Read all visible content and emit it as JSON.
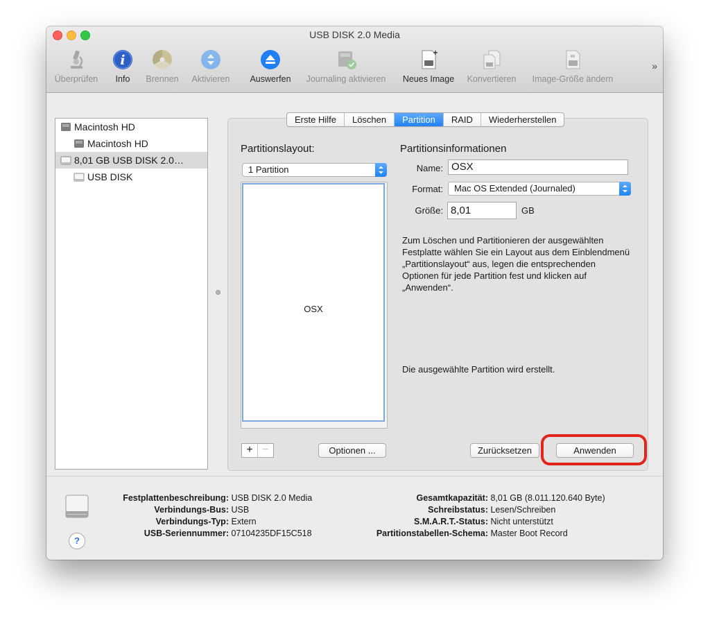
{
  "window": {
    "title": "USB DISK 2.0 Media"
  },
  "toolbar": {
    "items": [
      {
        "label": "Überprüfen",
        "icon": "microscope-icon",
        "enabled": false
      },
      {
        "label": "Info",
        "icon": "info-icon",
        "enabled": true
      },
      {
        "label": "Brennen",
        "icon": "burn-icon",
        "enabled": false
      },
      {
        "label": "Aktivieren",
        "icon": "mount-icon",
        "enabled": false
      },
      {
        "label": "Auswerfen",
        "icon": "eject-icon",
        "enabled": true
      },
      {
        "label": "Journaling aktivieren",
        "icon": "journaling-icon",
        "enabled": false
      },
      {
        "label": "Neues Image",
        "icon": "new-image-icon",
        "enabled": true
      },
      {
        "label": "Konvertieren",
        "icon": "convert-icon",
        "enabled": false
      },
      {
        "label": "Image-Größe ändern",
        "icon": "resize-image-icon",
        "enabled": false
      }
    ],
    "overflow": "»"
  },
  "sidebar": {
    "items": [
      {
        "label": "Macintosh HD",
        "indent": 0,
        "icon": "internal-disk-icon",
        "selected": false
      },
      {
        "label": "Macintosh HD",
        "indent": 1,
        "icon": "volume-icon",
        "selected": false
      },
      {
        "label": "8,01 GB USB DISK 2.0…",
        "indent": 0,
        "icon": "usb-disk-icon",
        "selected": true
      },
      {
        "label": "USB DISK",
        "indent": 1,
        "icon": "usb-volume-icon",
        "selected": false
      }
    ]
  },
  "tabs": {
    "items": [
      "Erste Hilfe",
      "Löschen",
      "Partition",
      "RAID",
      "Wiederherstellen"
    ],
    "active": "Partition"
  },
  "partition": {
    "layout_heading": "Partitionslayout:",
    "layout_value": "1 Partition",
    "partition_label": "OSX",
    "plus": "+",
    "minus": "−",
    "options_button": "Optionen ..."
  },
  "info": {
    "heading": "Partitionsinformationen",
    "name_label": "Name:",
    "name_value": "OSX",
    "format_label": "Format:",
    "format_value": "Mac OS Extended (Journaled)",
    "size_label": "Größe:",
    "size_value": "8,01",
    "size_unit": "GB",
    "description": "Zum Löschen und Partitionieren der ausgewählten Festplatte wählen Sie ein Layout aus dem Einblendmenü „Partitionslayout“ aus, legen die entsprechenden Optionen für jede Partition fest und klicken auf „Anwenden“.",
    "status": "Die ausgewählte Partition wird erstellt.",
    "revert_button": "Zurücksetzen",
    "apply_button": "Anwenden"
  },
  "footer": {
    "left": [
      {
        "key": "Festplattenbeschreibung",
        "value": "USB DISK 2.0 Media"
      },
      {
        "key": "Verbindungs-Bus",
        "value": "USB"
      },
      {
        "key": "Verbindungs-Typ",
        "value": "Extern"
      },
      {
        "key": "USB-Seriennummer",
        "value": "07104235DF15C518"
      }
    ],
    "right": [
      {
        "key": "Gesamtkapazität",
        "value": "8,01 GB (8.011.120.640 Byte)"
      },
      {
        "key": "Schreibstatus",
        "value": "Lesen/Schreiben"
      },
      {
        "key": "S.M.A.R.T.-Status",
        "value": "Nicht unterstützt"
      },
      {
        "key": "Partitionstabellen-Schema",
        "value": "Master Boot Record"
      }
    ],
    "help": "?"
  },
  "colors": {
    "accent": "#1f83f8",
    "highlight_ring": "#e1251b"
  }
}
